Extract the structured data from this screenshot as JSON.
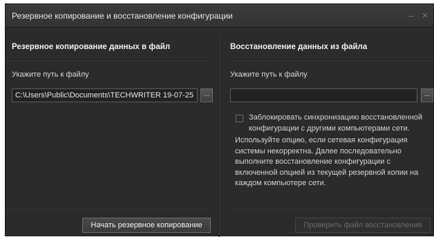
{
  "window": {
    "title": "Резервное копирование и восстановление конфигурации",
    "minimize_label": "–",
    "close_label": "×"
  },
  "backup": {
    "header": "Резервное копирование данных в файл",
    "path_label": "Укажите путь к файлу",
    "path_value": "C:\\Users\\Public\\Documents\\TECHWRITER 19-07-25",
    "browse_label": "...",
    "action_label": "Начать резервное копирование"
  },
  "restore": {
    "header": "Восстановление данных из файла",
    "path_label": "Укажите путь к файлу",
    "path_value": "",
    "browse_label": "...",
    "block_sync_label": "Заблокировать синхронизацию восстановленной конфигурации с другими компьютерами сети.",
    "block_sync_checked": false,
    "hint": "Используйте опцию, если сетевая конфигурация системы некорректна. Далее последовательно выполните восстановление конфигурации с включенной опцией из текущей резервной копии  на каждом компьютере сети.",
    "action_label": "Проверить файл восстановления",
    "action_enabled": false
  }
}
